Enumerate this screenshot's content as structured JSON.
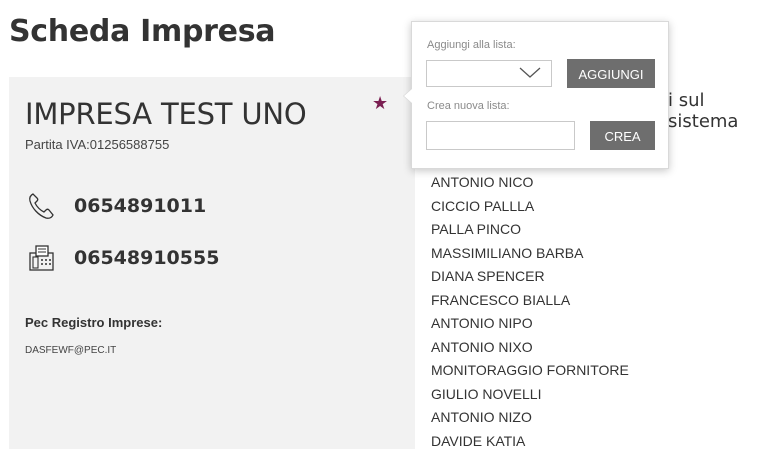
{
  "page": {
    "title": "Scheda Impresa"
  },
  "company": {
    "name": "IMPRESA TEST UNO",
    "vat": "Partita IVA:01256588755",
    "phone": "0654891011",
    "fax": "06548910555",
    "pec_label": "Pec Registro Imprese:",
    "pec_value": "DASFEWF@PEC.IT"
  },
  "popover": {
    "add_label": "Aggiungi alla lista:",
    "select_value": "",
    "add_button": "AGGIUNGI",
    "new_label": "Crea nuova lista:",
    "new_placeholder": "",
    "create_button": "CREA"
  },
  "right": {
    "header_partial": "i sul sistema",
    "names": [
      "ANTONIO NICO",
      "CICCIO PALLLA",
      "PALLA PINCO",
      "MASSIMILIANO BARBA",
      "DIANA SPENCER",
      "FRANCESCO BIALLA",
      "ANTONIO NIPO",
      "ANTONIO NIXO",
      "MONITORAGGIO FORNITORE",
      "GIULIO NOVELLI",
      "ANTONIO NIZO",
      "DAVIDE KATIA"
    ]
  },
  "colors": {
    "star": "#7b1f52",
    "button": "#6e6e6e",
    "panel": "#f2f2f2"
  },
  "icons": {
    "favorite": "star-icon",
    "phone": "phone-icon",
    "fax": "fax-icon",
    "dropdown": "chevron-down-icon"
  }
}
